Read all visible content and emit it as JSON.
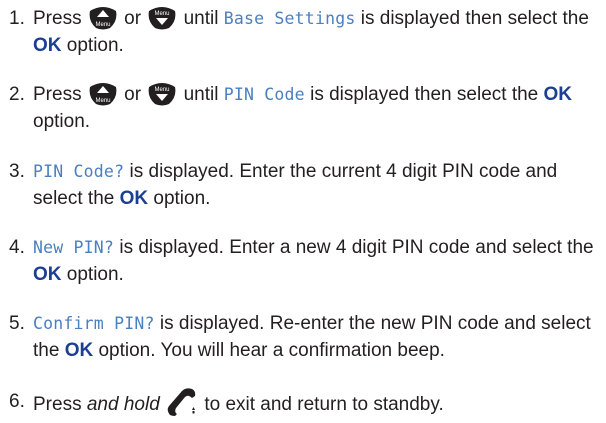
{
  "steps": [
    {
      "number": "1.",
      "segments": [
        {
          "text": "Press "
        },
        {
          "icon": "menu-up-key-icon"
        },
        {
          "text": " or "
        },
        {
          "icon": "menu-down-key-icon"
        },
        {
          "text": " until "
        },
        {
          "text": "Base Settings",
          "style": "lcd"
        },
        {
          "text": " is displayed then select the "
        },
        {
          "text": "OK",
          "style": "ok"
        },
        {
          "text": " option."
        }
      ]
    },
    {
      "number": "2.",
      "segments": [
        {
          "text": "Press "
        },
        {
          "icon": "menu-up-key-icon"
        },
        {
          "text": " or "
        },
        {
          "icon": "menu-down-key-icon"
        },
        {
          "text": " until "
        },
        {
          "text": "PIN Code",
          "style": "lcd"
        },
        {
          "text": " is displayed then select the "
        },
        {
          "text": "OK",
          "style": "ok"
        },
        {
          "text": " option."
        }
      ]
    },
    {
      "number": "3.",
      "segments": [
        {
          "text": "PIN Code?",
          "style": "lcd"
        },
        {
          "text": " is displayed. Enter the current 4 digit PIN code and select the "
        },
        {
          "text": "OK",
          "style": "ok"
        },
        {
          "text": " option."
        }
      ]
    },
    {
      "number": "4.",
      "segments": [
        {
          "text": "New PIN?",
          "style": "lcd"
        },
        {
          "text": " is displayed. Enter a new 4 digit PIN code and select the "
        },
        {
          "text": "OK",
          "style": "ok"
        },
        {
          "text": " option."
        }
      ]
    },
    {
      "number": "5.",
      "segments": [
        {
          "text": "Confirm PIN?",
          "style": "lcd"
        },
        {
          "text": " is displayed. Re-enter the new PIN code and select the "
        },
        {
          "text": "OK",
          "style": "ok"
        },
        {
          "text": " option. You will hear a confirmation beep."
        }
      ]
    },
    {
      "number": "6.",
      "segments": [
        {
          "text": "Press "
        },
        {
          "text": "and hold",
          "style": "italic"
        },
        {
          "text": " "
        },
        {
          "icon": "end-call-key-icon"
        },
        {
          "text": " to exit and return to standby."
        }
      ]
    }
  ],
  "icon_labels": {
    "menu": "Menu"
  },
  "colors": {
    "text": "#231f20",
    "lcd_text": "#4a7fc1",
    "ok_text": "#1c3f94",
    "icon_fill": "#231f20"
  }
}
